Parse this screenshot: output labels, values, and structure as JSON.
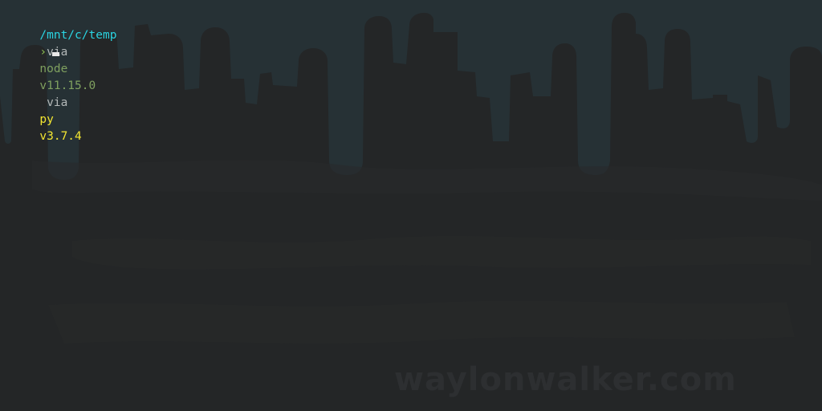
{
  "terminal": {
    "cwd": "/mnt/c/temp",
    "via_1": " via ",
    "node_label": "node ",
    "node_version": "v11.15.0",
    "via_2": " via ",
    "py_label": "py ",
    "py_version": "v3.7.4",
    "prompt_char": "›"
  },
  "watermark": "waylonwalker.com",
  "colors": {
    "background": "#242627",
    "drip": "#263135",
    "cwd": "#2ad4e2",
    "via": "#b3b8b8",
    "node": "#7fa05f",
    "python": "#f2e531",
    "prompt_char": "#8abf52",
    "cursor": "#e8e8e8",
    "watermark": "#2d2f31"
  }
}
